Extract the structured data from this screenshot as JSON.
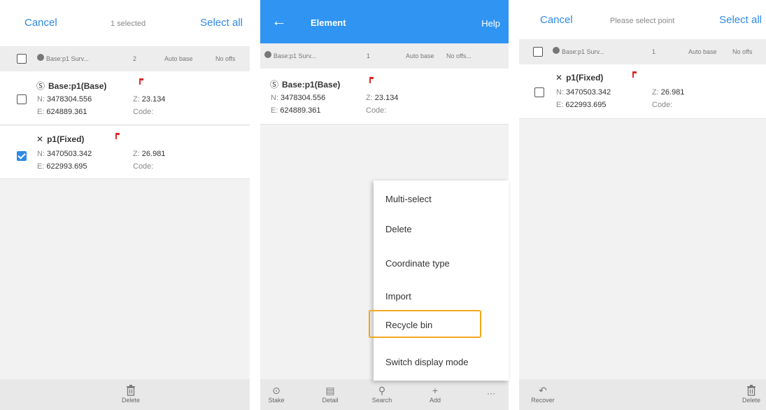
{
  "panel1": {
    "topbar": {
      "cancel": "Cancel",
      "status": "1 selected",
      "select_all": "Select all"
    },
    "header": {
      "name": "Base:p1 Surv...",
      "count": "2",
      "base": "Auto base",
      "offset": "No offs"
    },
    "rows": [
      {
        "symbol": "Ⓢ",
        "name": "Base:p1(Base)",
        "n_label": "N:",
        "n": "3478304.556",
        "e_label": "E:",
        "e": "624889.361",
        "z_label": "Z:",
        "z": "23.134",
        "code_label": "Code:",
        "checked": false
      },
      {
        "symbol": "✕",
        "name": "p1(Fixed)",
        "n_label": "N:",
        "n": "3470503.342",
        "e_label": "E:",
        "e": "622993.695",
        "z_label": "Z:",
        "z": "26.981",
        "code_label": "Code:",
        "checked": true
      }
    ],
    "bottom": {
      "delete": "Delete"
    }
  },
  "panel2": {
    "titlebar": {
      "back": "←",
      "title": "Element",
      "help": "Help"
    },
    "header": {
      "name": "Base:p1 Surv...",
      "count": "1",
      "base": "Auto base",
      "offset": "No offs..."
    },
    "row": {
      "symbol": "Ⓢ",
      "name": "Base:p1(Base)",
      "n_label": "N:",
      "n": "3478304.556",
      "e_label": "E:",
      "e": "624889.361",
      "z_label": "Z:",
      "z": "23.134",
      "code_label": "Code:"
    },
    "menu": [
      "Multi-select",
      "Delete",
      "Coordinate type",
      "Import",
      "Recycle bin",
      "Switch display mode"
    ],
    "highlighted": "Recycle bin",
    "toolbar": {
      "stake": "Stake",
      "detail": "Detail",
      "search": "Search",
      "add": "Add",
      "more": "···"
    }
  },
  "panel3": {
    "topbar": {
      "cancel": "Cancel",
      "status": "Please select point",
      "select_all": "Select all"
    },
    "header": {
      "name": "Base:p1 Surv...",
      "count": "1",
      "base": "Auto base",
      "offset": "No offs"
    },
    "row": {
      "symbol": "✕",
      "name": "p1(Fixed)",
      "n_label": "N:",
      "n": "3470503.342",
      "e_label": "E:",
      "e": "622993.695",
      "z_label": "Z:",
      "z": "26.981",
      "code_label": "Code:",
      "checked": false
    },
    "bottom": {
      "recover": "Recover",
      "delete": "Delete"
    }
  },
  "colors": {
    "accent": "#2f8ae5",
    "titlebar": "#2f94f2",
    "highlight": "#f2a81c",
    "flag": "#e02828"
  }
}
